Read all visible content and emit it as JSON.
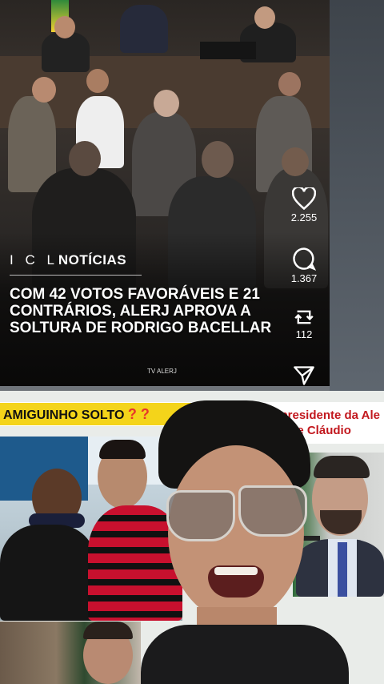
{
  "post": {
    "brand_prefix": "I C L",
    "brand_name": "NOTÍCIAS",
    "headline": "COM 42 VOTOS FAVORÁVEIS E 21 CONTRÁRIOS, ALERJ APROVA A SOLTURA DE RODRIGO BACELLAR",
    "credit": "TV ALERJ"
  },
  "actions": {
    "likes": "2.255",
    "comments": "1.367",
    "reposts": "112"
  },
  "overlay": {
    "banner_text": "AMIGUINHO SOLTO",
    "banner_marks": "? ?",
    "red_banner_line1": "do presidente da Ale",
    "red_banner_line2": "vida de Cláudio"
  },
  "colors": {
    "banner_yellow": "#f4d41a",
    "banner_red": "#c2181e",
    "flamengo_red": "#c8102e"
  }
}
